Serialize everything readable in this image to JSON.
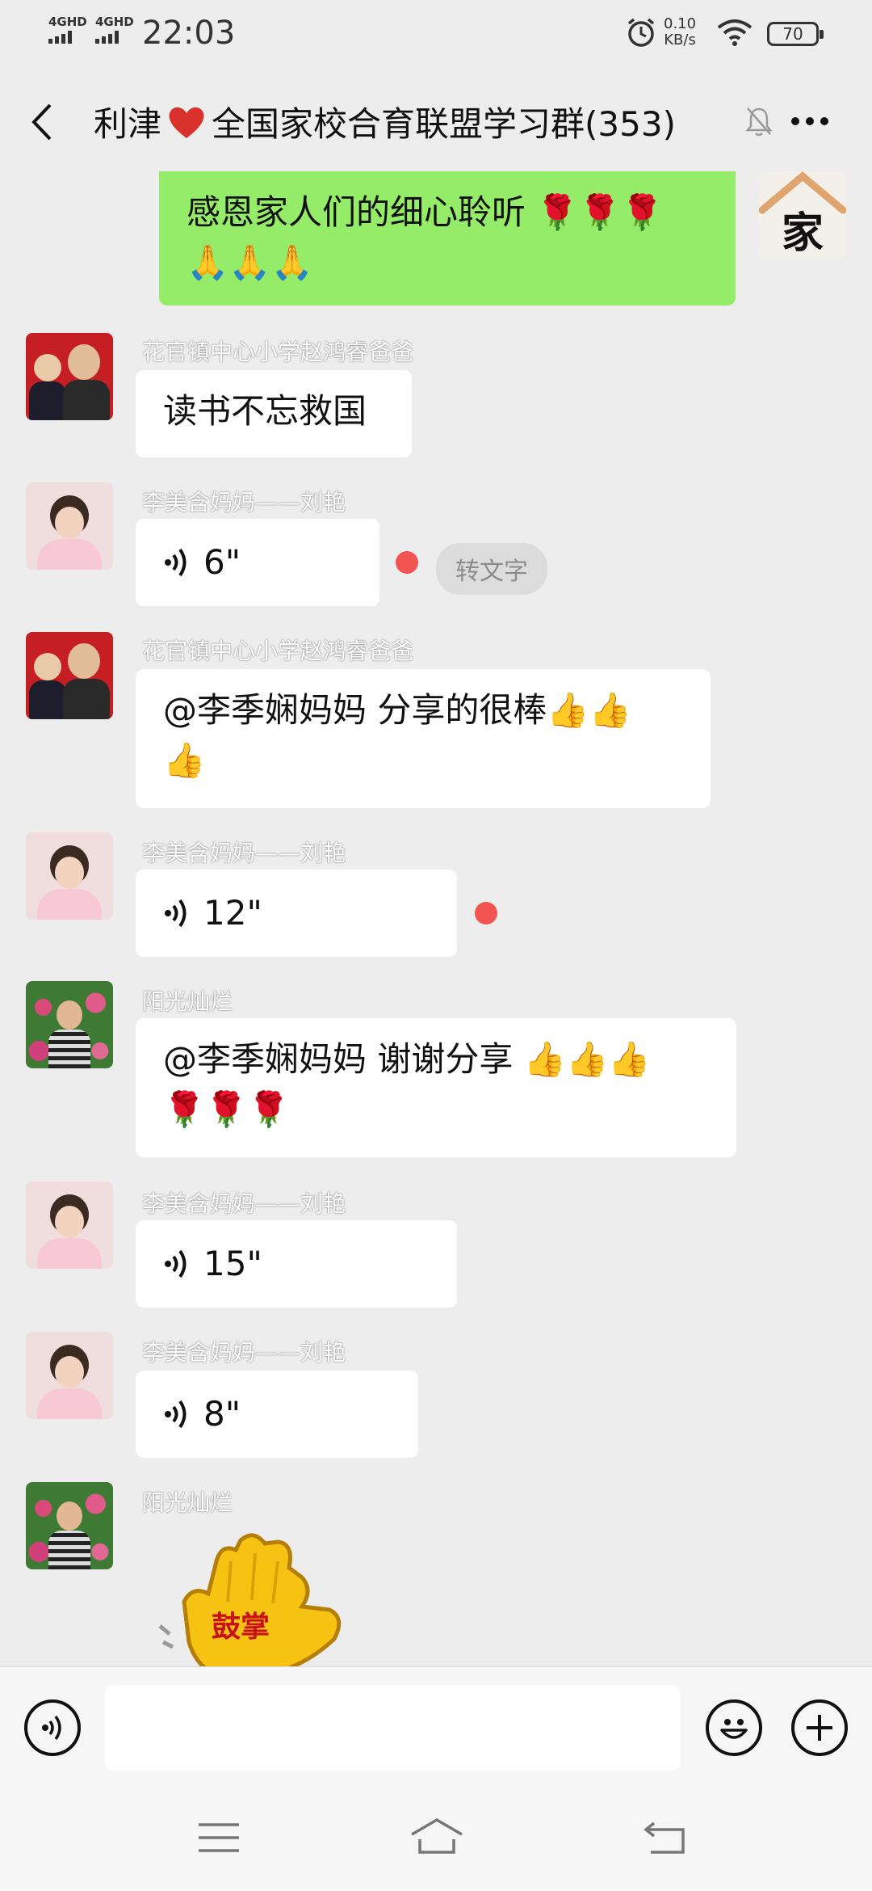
{
  "status_bar": {
    "signal1": "4GHD",
    "signal2": "4GHD",
    "time": "22:03",
    "speed_value": "0.10",
    "speed_unit": "KB/s",
    "battery": "70",
    "icons": [
      "alarm-icon",
      "wifi-icon",
      "battery-icon"
    ]
  },
  "header": {
    "title_part1": "利津",
    "title_part2": "全国家校合育联盟学习群(353)",
    "icons": [
      "back-icon",
      "heart-icon",
      "mute-bell-icon",
      "more-icon"
    ]
  },
  "messages": {
    "m0": {
      "text_line1": "感恩家人们的细心聆听 🌹🌹🌹",
      "text_line2": "🙏🙏🙏",
      "avatar_glyph": "家"
    },
    "m1": {
      "sender": "花官镇中心小学赵鸿睿爸爸",
      "text": "读书不忘救国"
    },
    "m2": {
      "sender": "李美含妈妈——刘艳",
      "duration": "6\"",
      "convert_label": "转文字"
    },
    "m3": {
      "sender": "花官镇中心小学赵鸿睿爸爸",
      "text_line1": "@李季娴妈妈  分享的很棒👍👍",
      "text_line2": "👍"
    },
    "m4": {
      "sender": "李美含妈妈——刘艳",
      "duration": "12\""
    },
    "m5": {
      "sender": "阳光灿烂",
      "text_line1": "@李季娴妈妈  谢谢分享 👍👍👍",
      "text_line2": "🌹🌹🌹"
    },
    "m6": {
      "sender": "李美含妈妈——刘艳",
      "duration": "15\""
    },
    "m7": {
      "sender": "李美含妈妈——刘艳",
      "duration": "8\""
    },
    "m8": {
      "sender": "阳光灿烂",
      "sticker_text": "鼓掌"
    }
  },
  "input_bar": {
    "icons": [
      "voice-mode-icon",
      "emoji-icon",
      "plus-icon"
    ]
  },
  "nav_bar": {
    "icons": [
      "menu-icon",
      "home-icon",
      "back-nav-icon"
    ]
  },
  "colors": {
    "background": "#ededed",
    "green_bubble": "#95ec69",
    "white_bubble": "#ffffff",
    "unread_dot": "#f25451"
  }
}
